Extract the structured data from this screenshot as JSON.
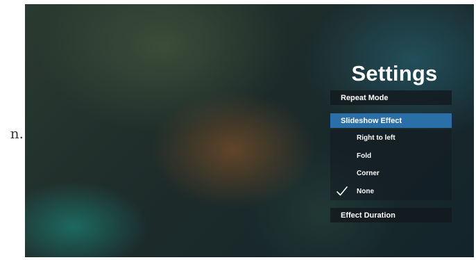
{
  "margin_text": "n.",
  "settings": {
    "title": "Settings",
    "items": {
      "repeat_mode": "Repeat Mode",
      "slideshow_effect": "Slideshow Effect",
      "effect_duration": "Effect Duration"
    },
    "slideshow_options": [
      {
        "label": "Right to left",
        "checked": false
      },
      {
        "label": "Fold",
        "checked": false
      },
      {
        "label": "Corner",
        "checked": false
      },
      {
        "label": "None",
        "checked": true
      }
    ],
    "colors": {
      "selected_row": "#2a6fa8",
      "text": "#ffffff"
    },
    "icons": {
      "checkmark": "check-icon"
    }
  }
}
